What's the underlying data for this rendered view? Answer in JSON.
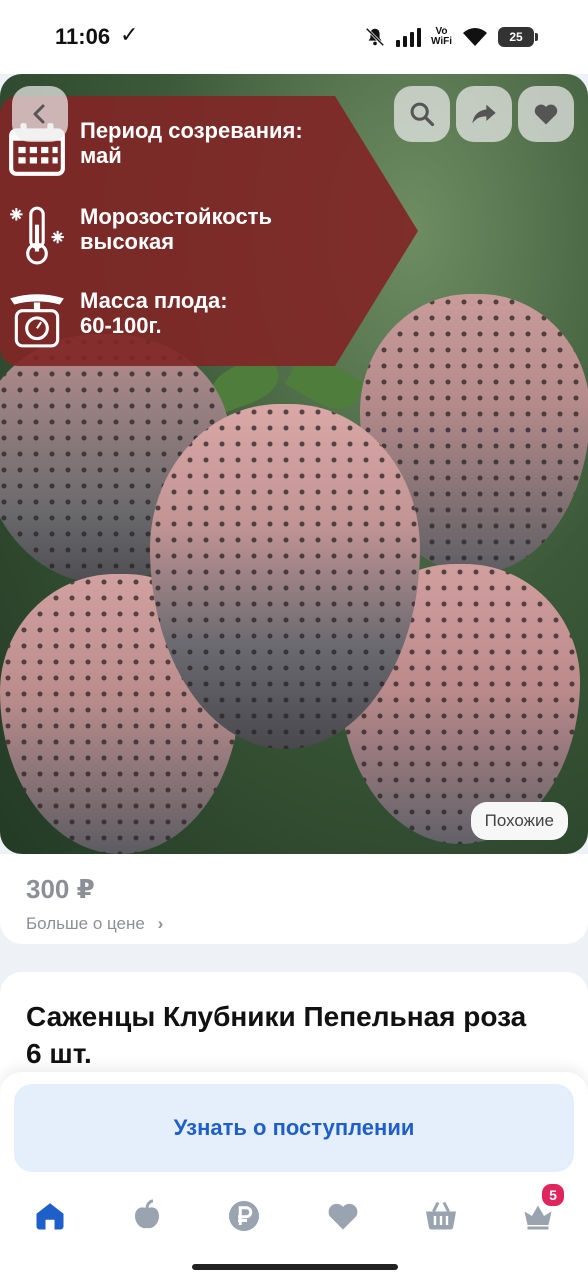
{
  "status_bar": {
    "time": "11:06",
    "check_glyph": "✓",
    "vowifi_top": "Vo",
    "vowifi_bottom": "WiFi",
    "battery": "25",
    "icons": [
      "download-done-icon",
      "bell-muted-icon",
      "signal-icon",
      "wifi-icon",
      "battery-icon"
    ]
  },
  "photo": {
    "info": [
      {
        "icon": "calendar-icon",
        "line1": "Период созревания:",
        "line2": "май"
      },
      {
        "icon": "thermometer-snow-icon",
        "line1": "Морозостойкость",
        "line2": "высокая"
      },
      {
        "icon": "scale-icon",
        "line1": "Масса плода:",
        "line2": "60-100г."
      }
    ],
    "buttons": [
      "back-icon",
      "search-icon",
      "share-icon",
      "heart-icon"
    ],
    "similar_label": "Похожие",
    "panel_color": "#802626"
  },
  "price": {
    "value": "300 ₽",
    "more_label": "Больше о цене",
    "more_chevron": "›"
  },
  "product": {
    "title": "Саженцы Клубники Пепельная роза 6 шт."
  },
  "action": {
    "notify_label": "Узнать о поступлении",
    "accent": "#1e5fc9"
  },
  "tabbar": {
    "items": [
      "home-icon",
      "catalog-icon",
      "ruble-icon",
      "heart-icon",
      "basket-icon",
      "crown-icon"
    ],
    "cart_badge": "5",
    "active_color": "#1e5fc9",
    "inactive_color": "#9aa3b0"
  }
}
